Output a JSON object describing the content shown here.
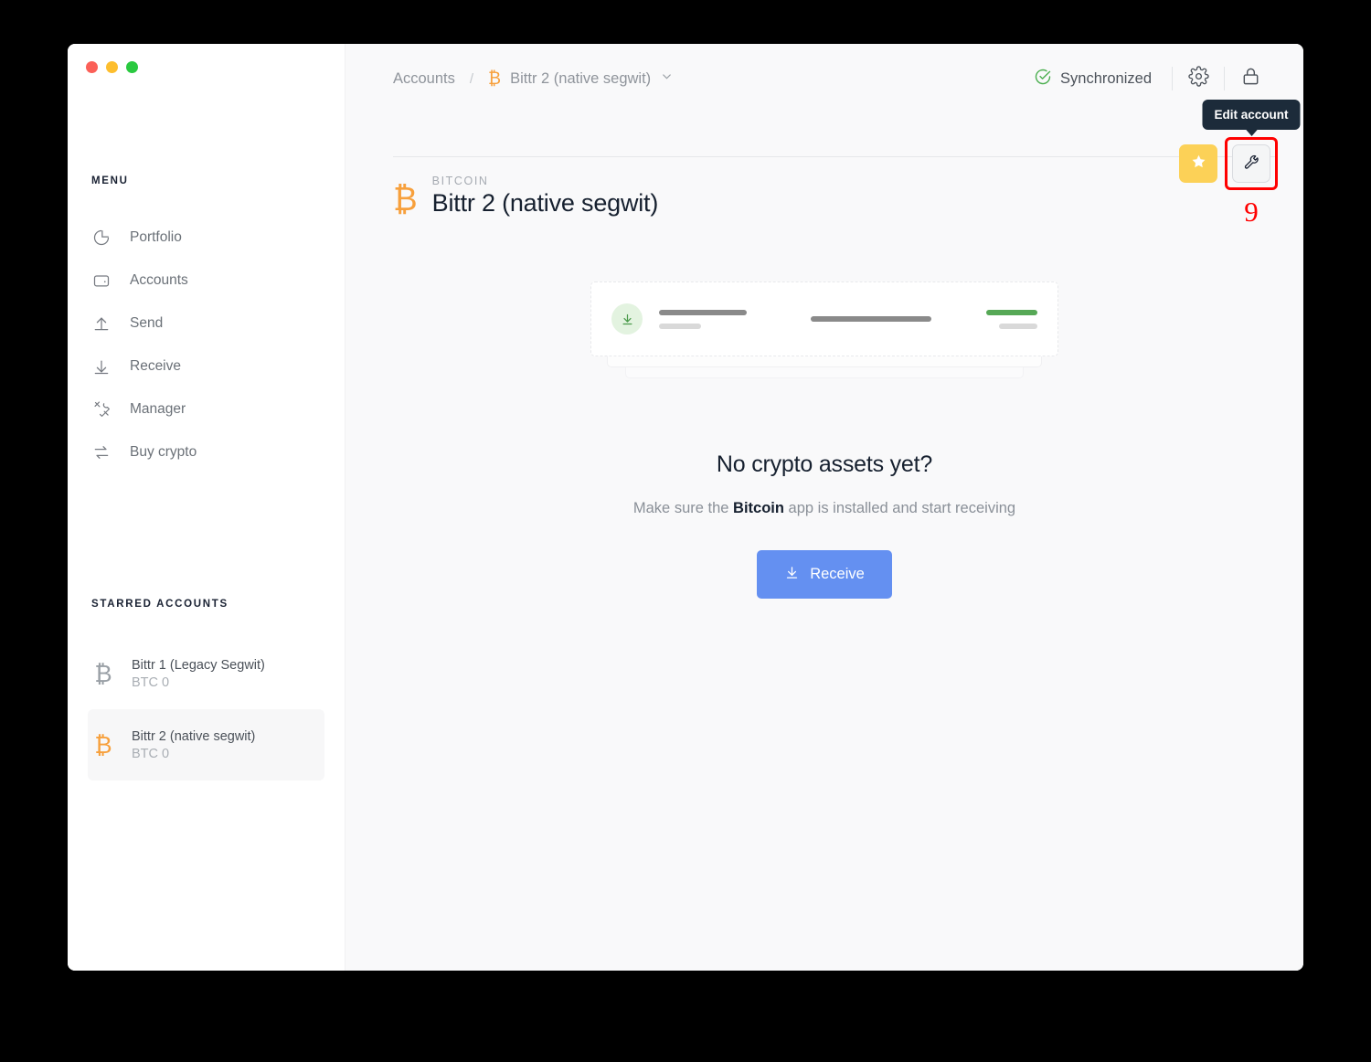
{
  "window": {
    "traffic_lights": [
      "close",
      "minimize",
      "maximize"
    ]
  },
  "sidebar": {
    "menu_label": "MENU",
    "menu_items": [
      {
        "label": "Portfolio",
        "icon": "pie-chart-icon"
      },
      {
        "label": "Accounts",
        "icon": "wallet-icon"
      },
      {
        "label": "Send",
        "icon": "arrow-up-icon"
      },
      {
        "label": "Receive",
        "icon": "arrow-down-icon"
      },
      {
        "label": "Manager",
        "icon": "tools-icon"
      },
      {
        "label": "Buy crypto",
        "icon": "swap-icon"
      }
    ],
    "starred_label": "STARRED ACCOUNTS",
    "accounts": [
      {
        "name": "Bittr 1 (Legacy Segwit)",
        "balance": "BTC 0",
        "icon": "bitcoin-icon",
        "selected": false
      },
      {
        "name": "Bittr 2 (native segwit)",
        "balance": "BTC 0",
        "icon": "bitcoin-icon",
        "selected": true
      }
    ]
  },
  "topbar": {
    "breadcrumb_root": "Accounts",
    "breadcrumb_separator": "/",
    "breadcrumb_current": "Bittr 2 (native segwit)",
    "sync_status": "Synchronized",
    "sync_color": "#4CAF50",
    "settings_icon": "gear-icon",
    "lock_icon": "lock-icon"
  },
  "account": {
    "kind": "BITCOIN",
    "title": "Bittr 2 (native segwit)",
    "star_button_color": "#FCD157",
    "edit_tooltip": "Edit account",
    "highlight_number": "9",
    "highlight_color": "#FF0000"
  },
  "empty_state": {
    "title": "No crypto assets yet?",
    "subtitle_prefix": "Make sure the ",
    "subtitle_bold": "Bitcoin",
    "subtitle_suffix": " app is installed and start receiving",
    "button_label": "Receive",
    "button_color": "#6490F1"
  }
}
